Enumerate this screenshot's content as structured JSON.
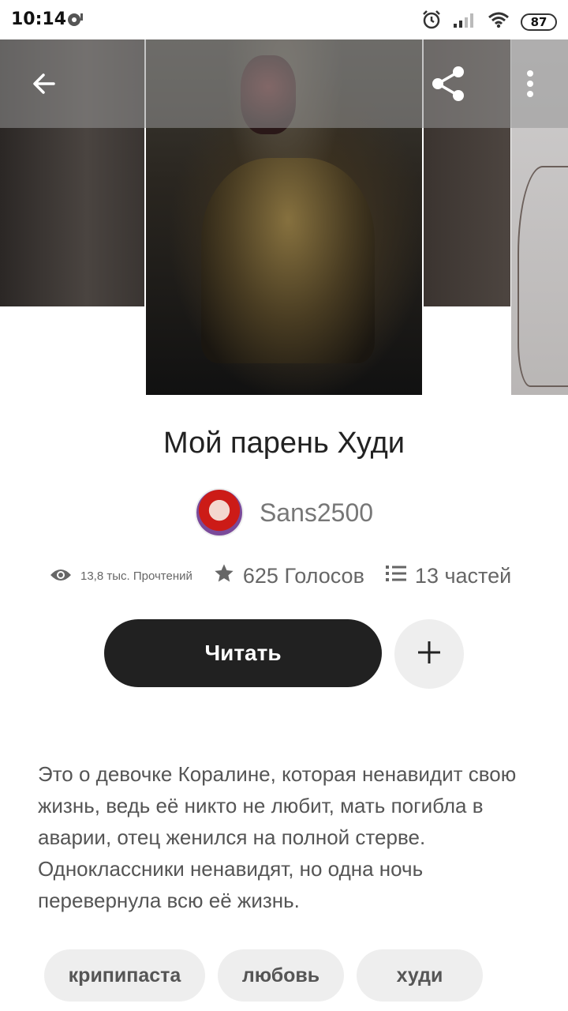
{
  "status_bar": {
    "time": "10:14",
    "battery": "87",
    "icons": [
      "notification-icon",
      "alarm-icon",
      "signal-icon",
      "wifi-icon",
      "battery-icon"
    ]
  },
  "toolbar": {
    "icons": [
      "back-arrow-icon",
      "share-icon",
      "more-vert-icon"
    ]
  },
  "story": {
    "title": "Мой парень Худи",
    "author": "Sans2500",
    "reads": "13,8 тыс. Прочтений",
    "votes": "625 Голосов",
    "parts": "13 частей",
    "read_label": "Читать",
    "description": "Это о девочке Коралине, которая ненавидит свою жизнь, ведь её никто не любит, мать погибла в аварии, отец женился на полной стерве. Одноклассники ненавидят, но одна ночь перевернула всю её жизнь."
  },
  "tags": [
    "крипипаста",
    "любовь",
    "худи"
  ],
  "colors": {
    "read_button": "#212121",
    "chip_bg": "#eeeeee",
    "text_secondary": "#666666"
  }
}
